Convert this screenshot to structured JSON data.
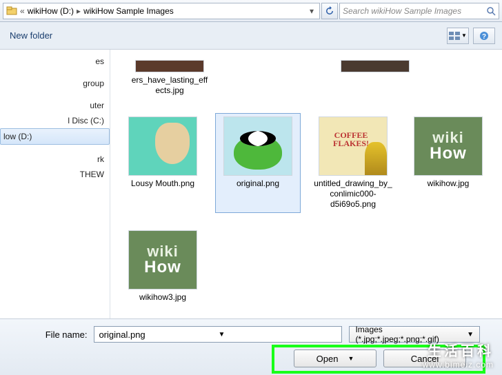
{
  "addressbar": {
    "drive_label": "wikiHow (D:)",
    "folder_label": "wikiHow Sample Images",
    "search_placeholder": "Search wikiHow Sample Images"
  },
  "toolbar": {
    "new_folder": "New folder"
  },
  "nav": {
    "items": [
      "es",
      "",
      "group",
      "",
      "uter",
      "l Disc (C:)"
    ],
    "selected": "low (D:)",
    "items2": [
      "",
      "rk",
      "THEW"
    ]
  },
  "files": {
    "partial1": "ers_have_lasting_effects.jpg",
    "partial2": "",
    "lousy": "Lousy Mouth.png",
    "original": "original.png",
    "untitled": "untitled_drawing_by_conlimic000-d5i69o5.png",
    "wikihow": "wikihow.jpg",
    "wikihow3": "wikihow3.jpg"
  },
  "bottom": {
    "filename_label": "File name:",
    "filename_value": "original.png",
    "filter_value": "Images (*.jpg;*.jpeg;*.png;*.gif)",
    "open": "Open",
    "cancel": "Cancel"
  },
  "watermark": {
    "line1": "生活百科",
    "line2": "www.bimeiz.com"
  }
}
